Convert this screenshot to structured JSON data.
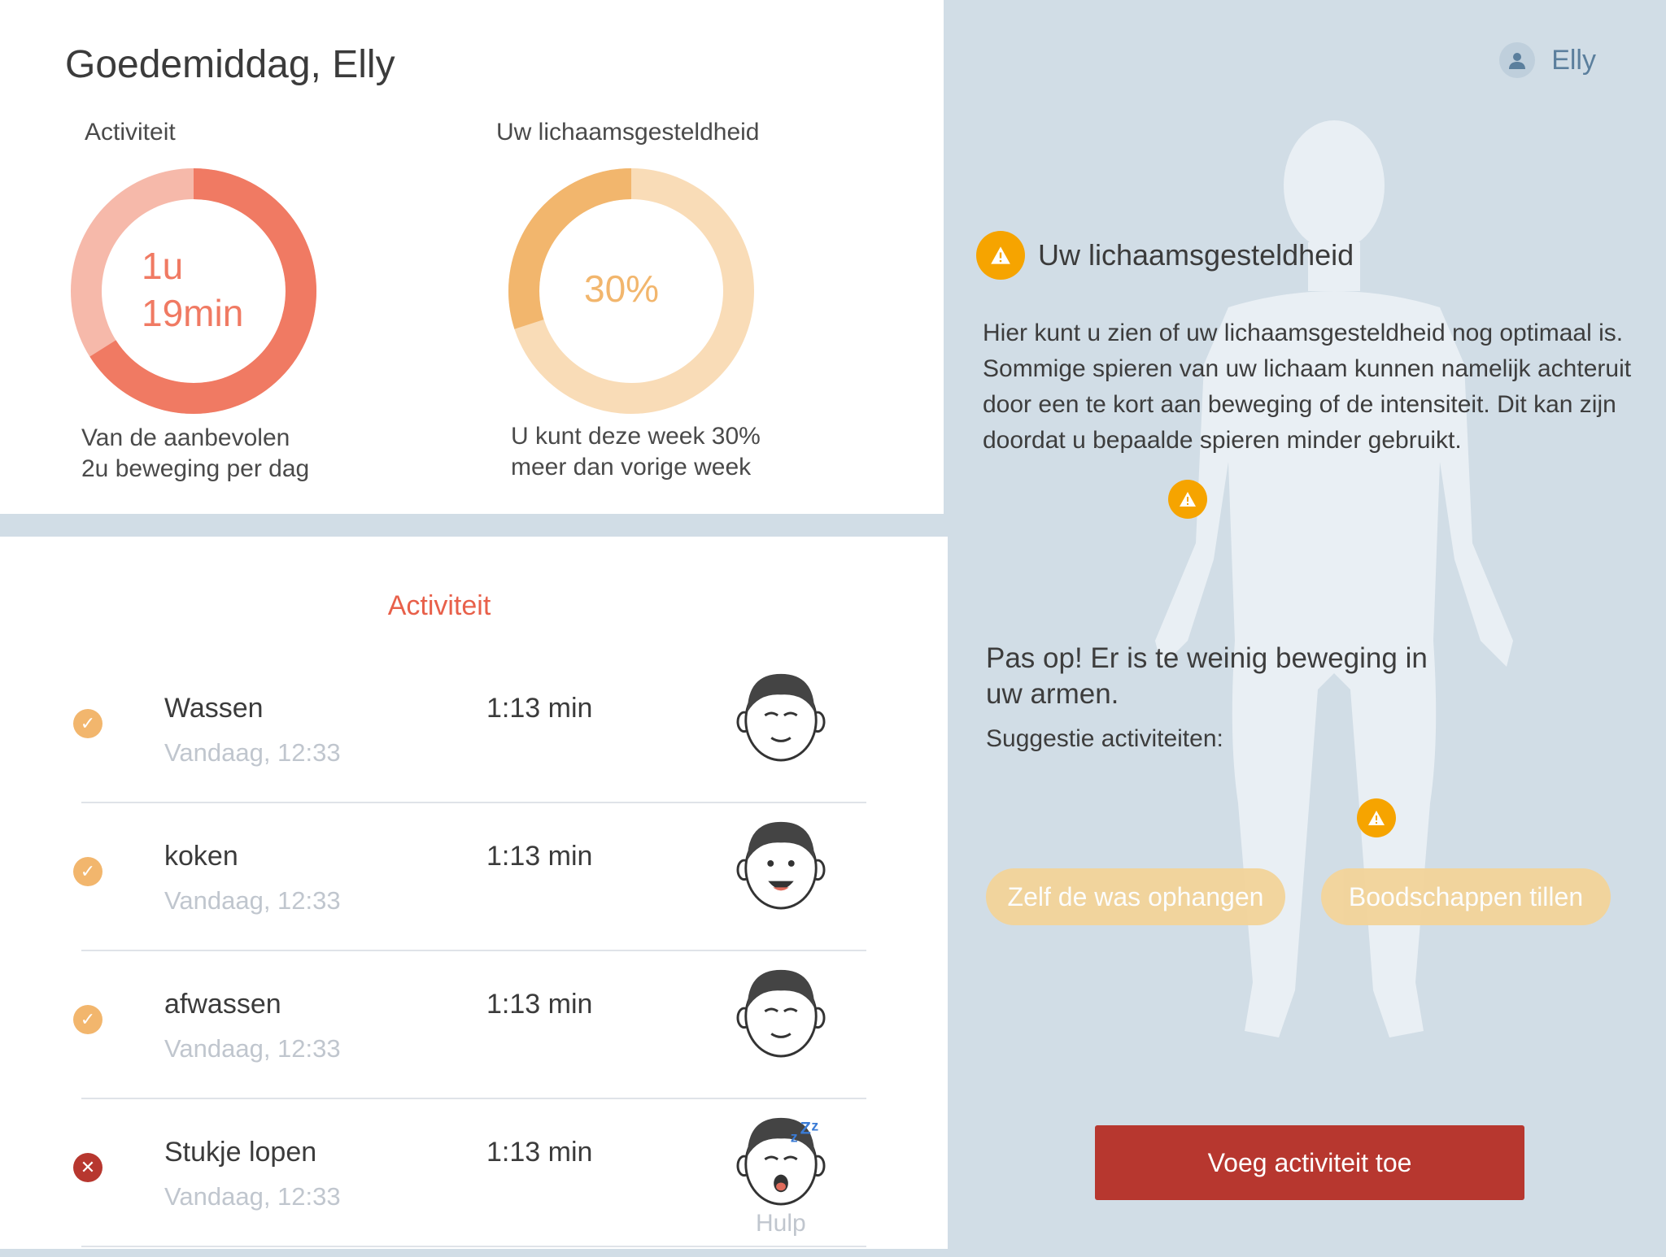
{
  "header": {
    "greeting": "Goedemiddag, Elly",
    "user_name": "Elly"
  },
  "activity_ring": {
    "title": "Activiteit",
    "value_line1": "1u",
    "value_line2": "19min",
    "caption_line1": "Van de aanbevolen",
    "caption_line2": "2u beweging per dag",
    "progress_fraction": 0.66,
    "color_main": "#f07a63",
    "color_track": "#f6b9aa"
  },
  "body_ring": {
    "title": "Uw lichaamsgesteldheid",
    "value": "30%",
    "caption_line1": "U kunt deze week 30%",
    "caption_line2": "meer dan vorige week",
    "progress_fraction": 0.3,
    "color_main": "#f2b66d",
    "color_track": "#f9dcb7"
  },
  "activity_list": {
    "title": "Activiteit",
    "items": [
      {
        "name": "Wassen",
        "time": "Vandaag, 12:33",
        "duration": "1:13 min",
        "status": "done",
        "face": "calm-face-icon"
      },
      {
        "name": "koken",
        "time": "Vandaag, 12:33",
        "duration": "1:13 min",
        "status": "done",
        "face": "happy-face-icon"
      },
      {
        "name": "afwassen",
        "time": "Vandaag, 12:33",
        "duration": "1:13 min",
        "status": "done",
        "face": "calm-face-icon"
      },
      {
        "name": "Stukje lopen",
        "time": "Vandaag, 12:33",
        "duration": "1:13 min",
        "status": "failed",
        "face": "tired-face-icon",
        "face_label": "Hulp"
      }
    ]
  },
  "body_panel": {
    "title": "Uw lichaamsgesteldheid",
    "description": "Hier kunt u zien of uw lichaamsgesteldheid nog optimaal is. Sommige spieren van uw lichaam kunnen namelijk achteruit door een te kort aan beweging of de intensiteit. Dit kan zijn doordat u bepaalde spieren minder gebruikt.",
    "warning": "Pas op! Er is te weinig beweging in uw armen.",
    "suggestions_label": "Suggestie activiteiten:",
    "suggestions": [
      "Zelf de was ophangen",
      "Boodschappen tillen"
    ],
    "add_button": "Voeg activiteit toe"
  },
  "colors": {
    "accent": "#e8604a",
    "warning": "#f6a400",
    "done": "#f2b66d",
    "failed": "#b7372f",
    "background": "#d1dde6"
  }
}
